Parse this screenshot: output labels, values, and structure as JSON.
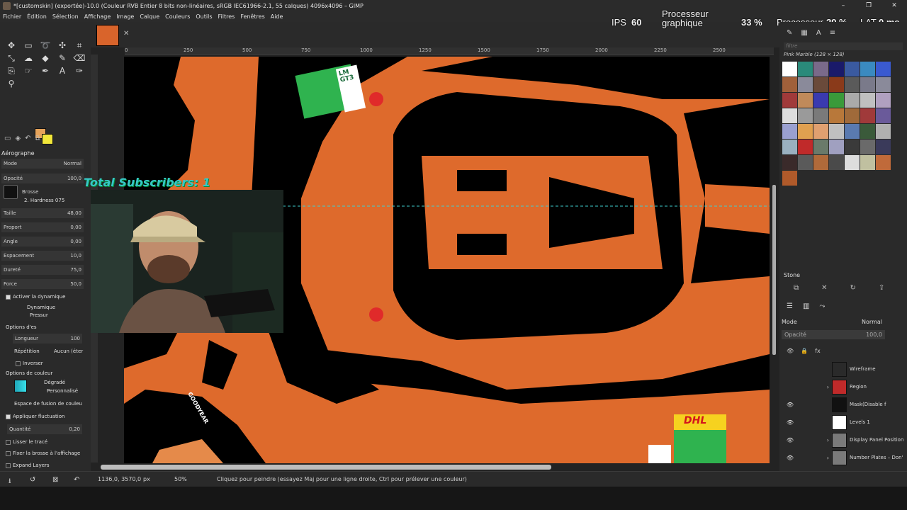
{
  "window": {
    "title": "*[customskin] (exportée)-10.0 (Couleur RVB Entier 8 bits non-linéaires, sRGB IEC61966-2.1, 55 calques) 4096x4096 – GIMP",
    "controls": [
      "–",
      "❐",
      "✕"
    ]
  },
  "menu": [
    "Fichier",
    "Édition",
    "Sélection",
    "Affichage",
    "Image",
    "Calque",
    "Couleurs",
    "Outils",
    "Filtres",
    "Fenêtres",
    "Aide"
  ],
  "overlay": {
    "ips_label": "IPS",
    "ips_value": "60",
    "gpu_label_1": "Processeur",
    "gpu_label_2": "graphique",
    "gpu_value": "33 %",
    "cpu_label": "Processeur",
    "cpu_value": "29 %",
    "lat_label": "LAT",
    "lat_value": "0 ms"
  },
  "tool_options": {
    "title": "Aérographe",
    "mode_label": "Mode",
    "mode_value": "Normal",
    "opacity_label": "Opacité",
    "opacity_value": "100,0",
    "brush_label": "Brosse",
    "brush_value": "2. Hardness 075",
    "size_label": "Taille",
    "size_value": "48,00",
    "ratio_label": "Proport",
    "ratio_value": "0,00",
    "angle_label": "Angle",
    "angle_value": "0,00",
    "spacing_label": "Espacement",
    "spacing_value": "10,0",
    "hardness_label": "Dureté",
    "hardness_value": "75,0",
    "force_label": "Force",
    "force_value": "50,0",
    "dynamics_toggle": "Activer la dynamique",
    "dynamics_label": "Dynamique",
    "dynamics_value": "Pressur",
    "dyn_options": "Options d'es",
    "length_label": "Longueur",
    "length_value": "100",
    "repeat_label": "Répétition",
    "repeat_value": "Aucun (éter",
    "invert_label": "Inverser",
    "color_options": "Options de couleur",
    "gradient_label": "Dégradé",
    "gradient_value": "Personnalisé",
    "blend_space": "Espace de fusion de couleu",
    "apply_jitter": "Appliquer fluctuation",
    "amount_label": "Quantité",
    "amount_value": "0,20",
    "smooth_label": "Lisser le tracé",
    "lock_brush": "Fixer la brosse à l'affichage",
    "expand_layers": "Expand Layers"
  },
  "ruler_ticks": [
    "0",
    "250",
    "500",
    "750",
    "1000",
    "1250",
    "1500",
    "1750",
    "2000",
    "2250",
    "2500"
  ],
  "canvas_texts": {
    "total_subscribers": "Total Subscribers: 1",
    "lm_gt3": "LM GT3",
    "goodyear": "GOODYEAR",
    "dhl": "DHL"
  },
  "patterns": {
    "filter_placeholder": "filtre",
    "selected_name": "Pink Marble (128 × 128)",
    "palette": [
      "#ffffff",
      "#2a8a7a",
      "#7a6a8a",
      "#1a1a6a",
      "#3a5aa0",
      "#3a8ac0",
      "#3a5ad0",
      "#a0603a",
      "#8a8a9a",
      "#6a4a3a",
      "#8a3a1a",
      "#5a5a5a",
      "#7a7a8a",
      "#8a8a9a",
      "#a03a3a",
      "#c08a5a",
      "#3a3ab0",
      "#3a9a3a",
      "#aaaaaa",
      "#c0c0c0",
      "#b0a0c0",
      "#ddd",
      "#9a9a9a",
      "#7a7a7a",
      "#b8783a",
      "#a06a3a",
      "#a03a3a",
      "#6a5a9a",
      "#9aa0d0",
      "#e0a050",
      "#e0a070",
      "#c0c0c0",
      "#5a7ab0",
      "#3a5a3a",
      "#b0b0b0",
      "#9ab0c0",
      "#c02a2a",
      "#6a7a6a",
      "#a0a0c0",
      "#3a3a3a",
      "#6a6a6a",
      "#3a3a5a",
      "#3a2a2a",
      "#5a5a5a",
      "#b06a3a",
      "#4a4a4a",
      "#ddd",
      "#c0c0a0",
      "#c06a3a",
      "#b05a2a"
    ]
  },
  "brushes": {
    "selected_name": "Stone"
  },
  "layers": {
    "mode_label": "Mode",
    "mode_value": "Normal",
    "opacity_label": "Opacité",
    "opacity_value": "100,0",
    "items": [
      {
        "name": "Wireframe",
        "visible": false,
        "thumb": "#2a2a2a"
      },
      {
        "name": "Region",
        "visible": false,
        "thumb": "#c02a2a"
      },
      {
        "name": "Mask(Disable f",
        "visible": true,
        "thumb": "#111111"
      },
      {
        "name": "Levels 1",
        "visible": true,
        "thumb": "#ffffff"
      },
      {
        "name": "Display Panel Position",
        "visible": true,
        "thumb": "#7a7a7a"
      },
      {
        "name": "Number Plates – Don'",
        "visible": true,
        "thumb": "#7a7a7a"
      }
    ]
  },
  "status": {
    "coords": "1136,0, 3570,0",
    "unit": "px",
    "zoom": "50%",
    "message": "Cliquez pour peindre (essayez Maj pour une ligne droite, Ctrl pour prélever une couleur)"
  }
}
